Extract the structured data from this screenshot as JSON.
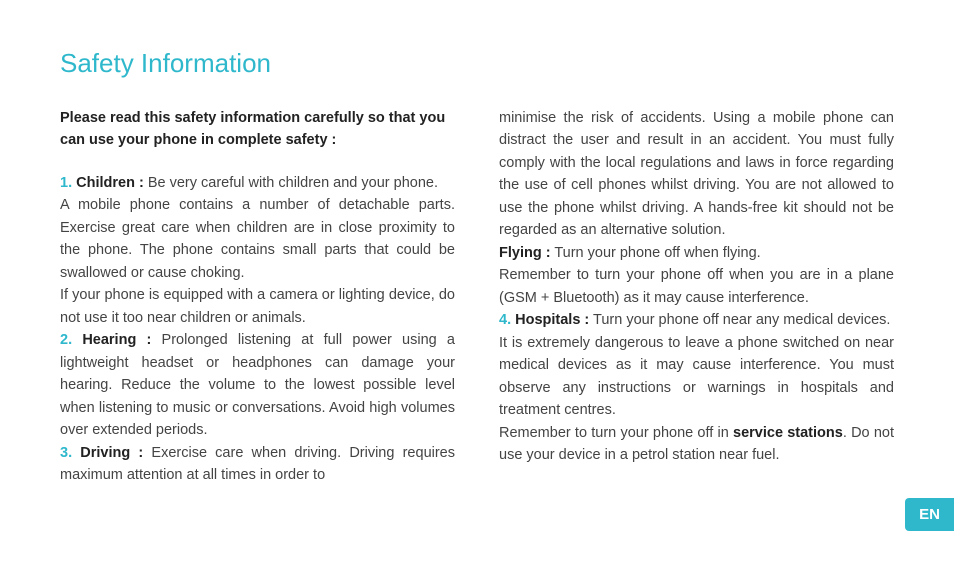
{
  "title": "Safety Information",
  "intro": "Please read this safety information carefully so that you can use your phone in complete safety :",
  "items": {
    "n1": "1.",
    "l1": "Children :",
    "t1a": " Be very careful with children and your phone.",
    "t1b": "A mobile phone contains a number of detachable parts. Exercise great care when children are in close proximity to the phone. The phone contains small parts that could be swallowed or cause choking.",
    "t1c": "If your phone is equipped with a camera or lighting device, do not use it too near children or animals.",
    "n2": "2.",
    "l2": "Hearing :",
    "t2": " Prolonged listening at full power using a lightweight headset or headphones can damage your hearing. Reduce the volume to the lowest possible level when listening to music or conversations. Avoid high volumes over extended periods.",
    "n3": "3.",
    "l3": "Driving :",
    "t3a": " Exercise care when driving. Driving requires maximum attention at all times in order to ",
    "t3b": "minimise the risk of accidents. Using a mobile phone can distract the user and result in an accident. You must fully comply with the local regulations and laws in force regarding the use of cell phones whilst driving. You are not allowed to use the phone whilst driving. A hands-free kit should not be regarded as an alternative solution.",
    "lFly": "Flying :",
    "tFlyA": " Turn your phone off when flying.",
    "tFlyB": "Remember to turn your phone off when you are in a plane (GSM + Bluetooth) as it may cause interference.",
    "n4": "4.",
    "l4": "Hospitals :",
    "t4a": " Turn your phone off near any medical devices.",
    "t4b": "It is extremely dangerous to leave a phone switched on near medical devices as it may cause interference. You must observe any instructions or warnings in hospitals and treatment centres.",
    "tSvcA": "Remember to turn your phone off in ",
    "lSvc": "service stations",
    "tSvcB": ". Do not use your device in a petrol station near fuel."
  },
  "lang": "EN"
}
